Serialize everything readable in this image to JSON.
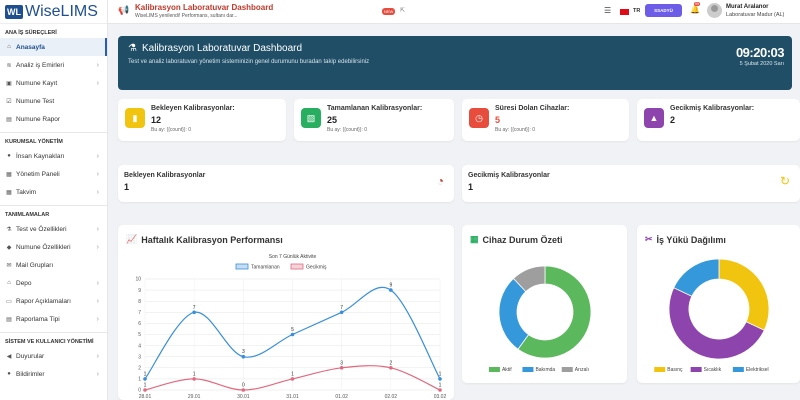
{
  "logo": {
    "prefix": "WL",
    "brand": "WiseLIMS"
  },
  "sidebar": {
    "sections": [
      {
        "title": "ANA İŞ SÜREÇLERİ",
        "items": [
          {
            "label": "Anasayfa",
            "icon": "home-icon",
            "glyph": "⌂",
            "active": true,
            "chevron": false
          },
          {
            "label": "Analiz iş Emirleri",
            "icon": "layers-icon",
            "glyph": "≋",
            "chevron": true
          },
          {
            "label": "Numune Kayıt",
            "icon": "box-icon",
            "glyph": "▣",
            "chevron": true
          },
          {
            "label": "Numune Test",
            "icon": "check-square-icon",
            "glyph": "☑",
            "chevron": false
          },
          {
            "label": "Numune Rapor",
            "icon": "file-icon",
            "glyph": "▤",
            "chevron": false
          }
        ]
      },
      {
        "title": "KURUMSAL YÖNETİM",
        "items": [
          {
            "label": "İnsan Kaynakları",
            "icon": "users-icon",
            "glyph": "●",
            "chevron": true
          },
          {
            "label": "Yönetim Paneli",
            "icon": "grid-icon",
            "glyph": "▦",
            "chevron": true
          },
          {
            "label": "Takvim",
            "icon": "calendar-icon",
            "glyph": "▦",
            "chevron": true
          }
        ]
      },
      {
        "title": "TANIMLAMALAR",
        "items": [
          {
            "label": "Test ve Özellikleri",
            "icon": "flask-icon",
            "glyph": "⚗",
            "chevron": true
          },
          {
            "label": "Numune Özellikleri",
            "icon": "tag-icon",
            "glyph": "◆",
            "chevron": true
          },
          {
            "label": "Mail Grupları",
            "icon": "mail-icon",
            "glyph": "✉",
            "chevron": false
          },
          {
            "label": "Depo",
            "icon": "warehouse-icon",
            "glyph": "⌂",
            "chevron": true
          },
          {
            "label": "Rapor Açıklamaları",
            "icon": "comment-icon",
            "glyph": "▭",
            "chevron": true
          },
          {
            "label": "Raporlama Tipi",
            "icon": "report-icon",
            "glyph": "▤",
            "chevron": true
          }
        ]
      },
      {
        "title": "SİSTEM VE KULLANICI YÖNETİMİ",
        "items": [
          {
            "label": "Duyurular",
            "icon": "megaphone-icon",
            "glyph": "◀",
            "chevron": true
          },
          {
            "label": "Bildirimler",
            "icon": "bell-icon",
            "glyph": "●",
            "chevron": true
          }
        ]
      }
    ]
  },
  "topbar": {
    "title": "Kalibrasyon Laboratuvar Dashboard",
    "subtitle": "WiseLIMS yenilendi! Performans, sultanı dar...",
    "badge": "NEW",
    "lang": "TR",
    "button": "SSADYÜ",
    "notif_count": "99",
    "user_name": "Murat Aralanor",
    "user_role": "Laboratuvar Madur (AL)"
  },
  "banner": {
    "title": "Kalibrasyon Laboratuvar Dashboard",
    "subtitle": "Test ve analiz laboratuvarı yönetim sisteminizin genel durumunu buradan takip edebilirsiniz",
    "time": "09:20:03",
    "date": "5 Şubat 2020 Sarı"
  },
  "stats": [
    {
      "label": "Bekleyen Kalibrasyonlar:",
      "value": "12",
      "sub": "Bu ay: {{count}}: 0",
      "color": "#f1c40f",
      "icon": "fuel-icon",
      "glyph": "▮"
    },
    {
      "label": "Tamamlanan Kalibrasyonlar:",
      "value": "25",
      "sub": "Bu ay: {{count}}: 0",
      "color": "#27ae60",
      "icon": "certificate-icon",
      "glyph": "▧"
    },
    {
      "label": "Süresi Dolan Cihazlar:",
      "value": "5",
      "sub": "Bu ay: {{count}}: 0",
      "color": "#e74c3c",
      "icon": "clock-icon",
      "glyph": "◷",
      "value_color": "#e74c3c"
    },
    {
      "label": "Gecikmiş Kalibrasyonlar:",
      "value": "2",
      "sub": "",
      "color": "#8e44ad",
      "icon": "warning-icon",
      "glyph": "▲"
    }
  ],
  "wide": [
    {
      "label": "Bekleyen Kalibrasyonlar",
      "value": "1",
      "icon": "history-icon",
      "glyph": "◔",
      "color": "#c0392b"
    },
    {
      "label": "Gecikmiş Kalibrasyonlar",
      "value": "1",
      "icon": "refresh-icon",
      "glyph": "↻",
      "color": "#f1c40f"
    }
  ],
  "panels": {
    "performance": "Haftalık Kalibrasyon Performansı",
    "device": "Cihaz Durum Özeti",
    "workload": "İş Yükü Dağılımı"
  },
  "chart_data": [
    {
      "type": "line",
      "title": "Son 7 Günlük Aktivite",
      "categories": [
        "28.01",
        "29.01",
        "30.01",
        "31.01",
        "01.02",
        "02.02",
        "03.02"
      ],
      "series": [
        {
          "name": "Tamamlanan",
          "values": [
            1,
            7,
            3,
            5,
            7,
            9,
            1
          ],
          "color": "#3a8fd9"
        },
        {
          "name": "Gecikmiş",
          "values": [
            0,
            1,
            0,
            1,
            2,
            2,
            0
          ],
          "color": "#e06b80"
        }
      ],
      "ylim": [
        0,
        10
      ],
      "yticks": [
        "0",
        "1",
        "2",
        "3",
        "4",
        "5",
        "6",
        "7",
        "8",
        "9",
        "10"
      ],
      "value_labels": [
        [
          "1",
          "7",
          "3",
          "5",
          "7",
          "9",
          "1"
        ],
        [
          "1",
          "1",
          "0",
          "1",
          "3",
          "2",
          "1"
        ]
      ],
      "grid": true,
      "legend": "top"
    },
    {
      "type": "pie",
      "title": "",
      "labels": [
        "Aktif",
        "Bakımda",
        "Arızalı"
      ],
      "values": [
        60,
        28,
        12
      ],
      "colors": [
        "#5cb85c",
        "#3498db",
        "#9e9e9e"
      ],
      "donut": true,
      "legend": "bottom"
    },
    {
      "type": "pie",
      "title": "",
      "labels": [
        "Basınç",
        "Sıcaklık",
        "Elektriksel"
      ],
      "values": [
        32,
        50,
        18
      ],
      "colors": [
        "#f1c40f",
        "#8e44ad",
        "#3498db"
      ],
      "donut": true,
      "legend": "bottom"
    }
  ]
}
